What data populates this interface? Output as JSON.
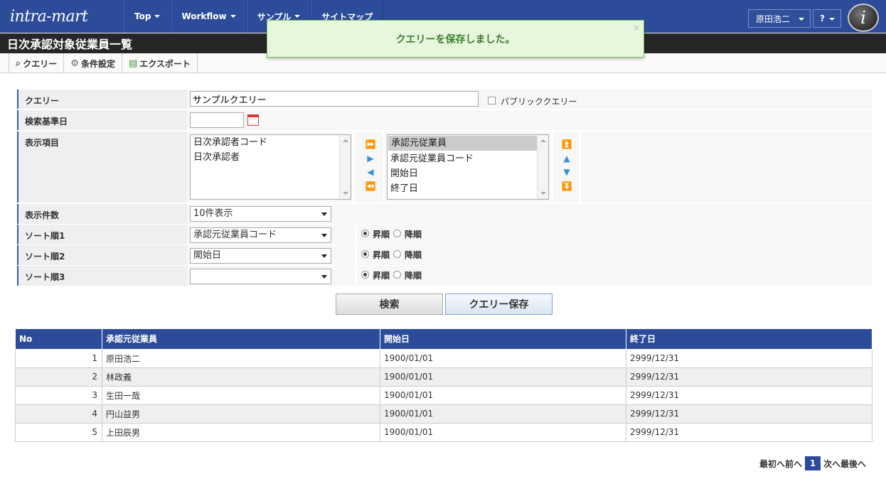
{
  "header": {
    "logo_text": "intra-mart",
    "menu": [
      {
        "label": "Top"
      },
      {
        "label": "Workflow"
      },
      {
        "label": "サンプル"
      },
      {
        "label": "サイトマップ"
      }
    ],
    "user_name": "原田浩二",
    "help_label": "?",
    "brand_icon_letter": "i"
  },
  "page_title": "日次承認対象従業員一覧",
  "toolbar": {
    "items": [
      {
        "label": "クエリー",
        "icon": "search-icon"
      },
      {
        "label": "条件設定",
        "icon": "gear-icon"
      },
      {
        "label": "エクスポート",
        "icon": "export-icon"
      }
    ]
  },
  "toast": {
    "message": "クエリーを保存しました。",
    "close": "×"
  },
  "form": {
    "query_label": "クエリー",
    "query_value": "サンプルクエリー",
    "public_label": "パブリッククエリー",
    "base_date_label": "検索基準日",
    "base_date_value": "",
    "display_items_label": "表示項目",
    "available_items": [
      "日次承認者コード",
      "日次承認者"
    ],
    "selected_items": [
      "承認元従業員",
      "承認元従業員コード",
      "開始日",
      "終了日"
    ],
    "count_label": "表示件数",
    "count_value": "10件表示",
    "sort1_label": "ソート順1",
    "sort1_value": "承認元従業員コード",
    "sort2_label": "ソート順2",
    "sort2_value": "開始日",
    "sort3_label": "ソート順3",
    "sort3_value": "",
    "asc_label": "昇順",
    "desc_label": "降順",
    "search_button": "検索",
    "save_button": "クエリー保存"
  },
  "table": {
    "columns": [
      "No",
      "承認元従業員",
      "開始日",
      "終了日"
    ],
    "rows": [
      {
        "no": "1",
        "name": "原田浩二",
        "start": "1900/01/01",
        "end": "2999/12/31"
      },
      {
        "no": "2",
        "name": "林政義",
        "start": "1900/01/01",
        "end": "2999/12/31"
      },
      {
        "no": "3",
        "name": "生田一哉",
        "start": "1900/01/01",
        "end": "2999/12/31"
      },
      {
        "no": "4",
        "name": "円山益男",
        "start": "1900/01/01",
        "end": "2999/12/31"
      },
      {
        "no": "5",
        "name": "上田辰男",
        "start": "1900/01/01",
        "end": "2999/12/31"
      }
    ]
  },
  "pager": {
    "first": "最初へ",
    "prev": "前へ",
    "current": "1",
    "next": "次へ",
    "last": "最後へ"
  },
  "colors": {
    "header_blue": "#2c4c9a",
    "title_bar": "#262626",
    "toast_bg": "#e6f7de",
    "toast_text": "#3c7c28",
    "arrow_blue": "#3b8fd8"
  }
}
